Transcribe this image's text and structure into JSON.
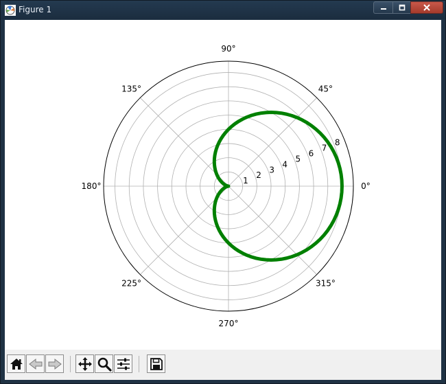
{
  "window": {
    "title": "Figure 1",
    "icon": "matplotlib-figure-icon",
    "controls": [
      "minimize-icon",
      "maximize-icon",
      "close-icon"
    ]
  },
  "toolbar": {
    "buttons": [
      {
        "name": "home",
        "icon": "home-icon"
      },
      {
        "name": "back",
        "icon": "back-arrow-icon"
      },
      {
        "name": "forward",
        "icon": "forward-arrow-icon"
      },
      {
        "name": "pan",
        "icon": "move-icon"
      },
      {
        "name": "zoom",
        "icon": "zoom-icon"
      },
      {
        "name": "subplots",
        "icon": "sliders-icon"
      },
      {
        "name": "save",
        "icon": "save-icon"
      }
    ]
  },
  "chart_data": {
    "type": "line",
    "projection": "polar",
    "title": "",
    "angle_ticks": [
      "0°",
      "45°",
      "90°",
      "135°",
      "180°",
      "225°",
      "270°",
      "315°"
    ],
    "angle_tick_values_deg": [
      0,
      45,
      90,
      135,
      180,
      225,
      270,
      315
    ],
    "radial_ticks": [
      "1",
      "2",
      "3",
      "4",
      "5",
      "6",
      "7",
      "8"
    ],
    "radial_tick_values": [
      1,
      2,
      3,
      4,
      5,
      6,
      7,
      8
    ],
    "rlim": [
      0,
      8.8
    ],
    "grid": true,
    "series": [
      {
        "curve": "cardioid r = 4(1 + cos θ)",
        "color": "#008000",
        "theta_deg": [
          0,
          30,
          60,
          90,
          120,
          150,
          180,
          210,
          240,
          270,
          300,
          330,
          360
        ],
        "r": [
          8.0,
          7.46,
          6.0,
          4.0,
          2.0,
          0.54,
          0.0,
          0.54,
          2.0,
          4.0,
          6.0,
          7.46,
          8.0
        ]
      }
    ]
  }
}
